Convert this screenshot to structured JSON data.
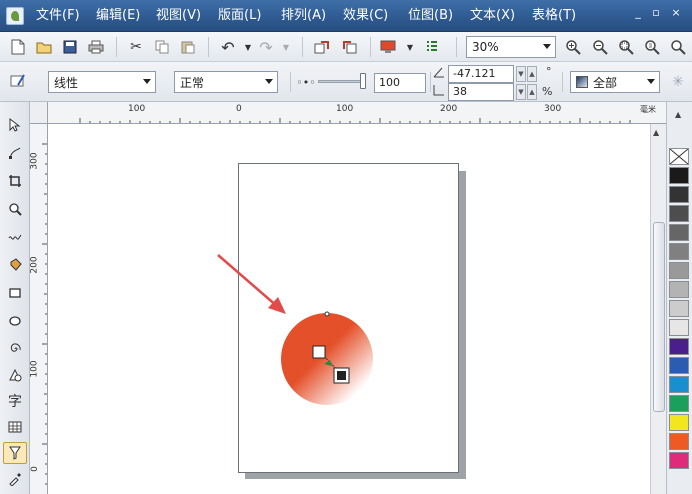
{
  "menubar": {
    "items": [
      "文件(F)",
      "编辑(E)",
      "视图(V)",
      "版面(L)",
      "排列(A)",
      "效果(C)",
      "位图(B)",
      "文本(X)",
      "表格(T)"
    ],
    "window_buttons": [
      "_",
      "▫",
      "×"
    ]
  },
  "standard_toolbar": {
    "zoom_value": "30%"
  },
  "property_bar": {
    "transparency_type": "线性",
    "merge_mode": "正常",
    "midpoint_value": "100",
    "angle_value": "-47.121",
    "angle_unit": "°",
    "edge_value": "38",
    "edge_unit": "%",
    "target_value": "全部"
  },
  "rulers": {
    "top_labels": [
      "100",
      "0",
      "100",
      "200",
      "300"
    ],
    "top_unit": "毫米",
    "left_labels": [
      "300",
      "200",
      "100",
      "0"
    ]
  },
  "colors": {
    "menubar": "#2f5b92",
    "shape_fill": "#e4502a",
    "arrow": "#e34a4a"
  },
  "palette": [
    "#ffffff",
    "#1a1a1a",
    "#333333",
    "#4d4d4d",
    "#666666",
    "#808080",
    "#999999",
    "#b3b3b3",
    "#cccccc",
    "#e6e6e6",
    "#4a1e8c",
    "#2a5db0",
    "#1a8fd0",
    "#1aa05a",
    "#f2e61e",
    "#ee5a24",
    "#e02a7a"
  ],
  "icons": {
    "standard": [
      "new-icon",
      "open-icon",
      "save-icon",
      "print-icon",
      "cut-icon",
      "copy-icon",
      "paste-icon",
      "undo-icon",
      "redo-icon",
      "import-icon",
      "export-icon",
      "launcher-icon",
      "options-icon",
      "zoom-in-icon",
      "zoom-out-icon",
      "zoom-fit-icon",
      "zoom-page-icon",
      "zoom-selection-icon"
    ],
    "tools": [
      "pick-tool-icon",
      "shape-tool-icon",
      "crop-tool-icon",
      "zoom-tool-icon",
      "freehand-tool-icon",
      "smart-fill-icon",
      "rectangle-tool-icon",
      "ellipse-tool-icon",
      "spiral-tool-icon",
      "basic-shapes-icon",
      "text-tool-icon",
      "table-tool-icon",
      "transparency-tool-icon",
      "eyedropper-tool-icon"
    ]
  }
}
